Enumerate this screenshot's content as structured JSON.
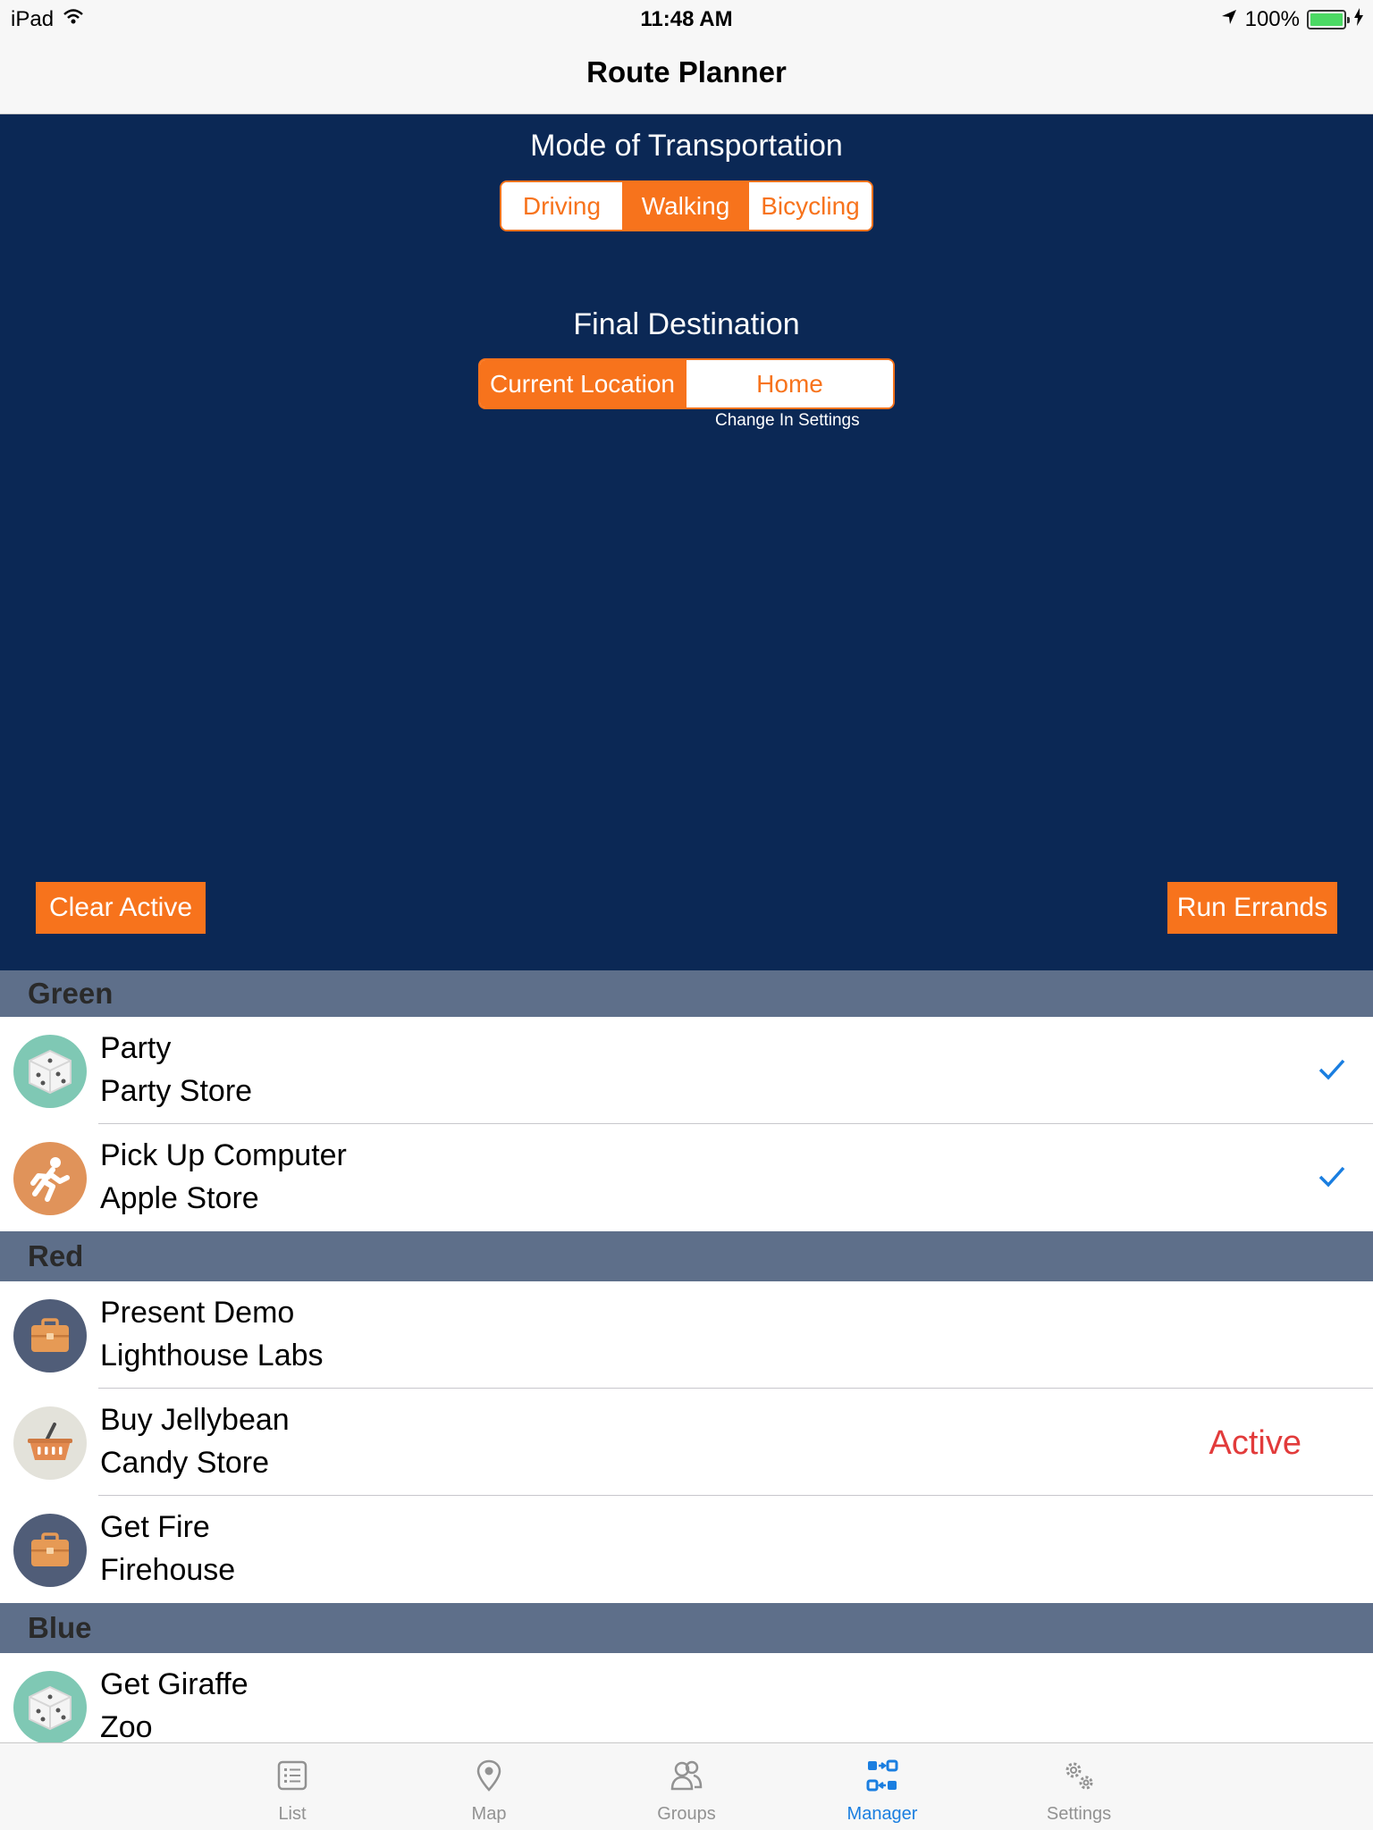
{
  "status_bar": {
    "device": "iPad",
    "time": "11:48 AM",
    "battery": "100%"
  },
  "nav": {
    "title": "Route Planner"
  },
  "transport": {
    "label": "Mode of Transportation",
    "options": [
      "Driving",
      "Walking",
      "Bicycling"
    ],
    "selected": "Walking"
  },
  "destination": {
    "label": "Final Destination",
    "options": [
      "Current Location",
      "Home"
    ],
    "selected": "Current Location",
    "hint": "Change In Settings"
  },
  "buttons": {
    "clear_active": "Clear Active",
    "run_errands": "Run Errands"
  },
  "groups": [
    {
      "name": "Green",
      "items": [
        {
          "title": "Party",
          "subtitle": "Party Store",
          "icon": "dice-icon",
          "checked": true,
          "status": ""
        },
        {
          "title": "Pick Up Computer",
          "subtitle": "Apple Store",
          "icon": "running-person-icon",
          "checked": true,
          "status": ""
        }
      ]
    },
    {
      "name": "Red",
      "items": [
        {
          "title": "Present Demo",
          "subtitle": "Lighthouse Labs",
          "icon": "briefcase-icon",
          "checked": false,
          "status": ""
        },
        {
          "title": "Buy Jellybean",
          "subtitle": "Candy Store",
          "icon": "basket-icon",
          "checked": false,
          "status": "Active"
        },
        {
          "title": "Get Fire",
          "subtitle": "Firehouse",
          "icon": "briefcase-icon",
          "checked": false,
          "status": ""
        }
      ]
    },
    {
      "name": "Blue",
      "items": [
        {
          "title": "Get Giraffe",
          "subtitle": "Zoo",
          "icon": "dice-icon",
          "checked": false,
          "status": ""
        }
      ]
    }
  ],
  "tabs": [
    {
      "label": "List",
      "icon": "list-icon",
      "active": false
    },
    {
      "label": "Map",
      "icon": "map-pin-icon",
      "active": false
    },
    {
      "label": "Groups",
      "icon": "groups-icon",
      "active": false
    },
    {
      "label": "Manager",
      "icon": "manager-icon",
      "active": true
    },
    {
      "label": "Settings",
      "icon": "gears-icon",
      "active": false
    }
  ],
  "colors": {
    "accent": "#f7731c",
    "panel": "#0b2855",
    "group_header": "#5e6f8a",
    "tint": "#1a7ee0",
    "active_status": "#e23b3b"
  }
}
